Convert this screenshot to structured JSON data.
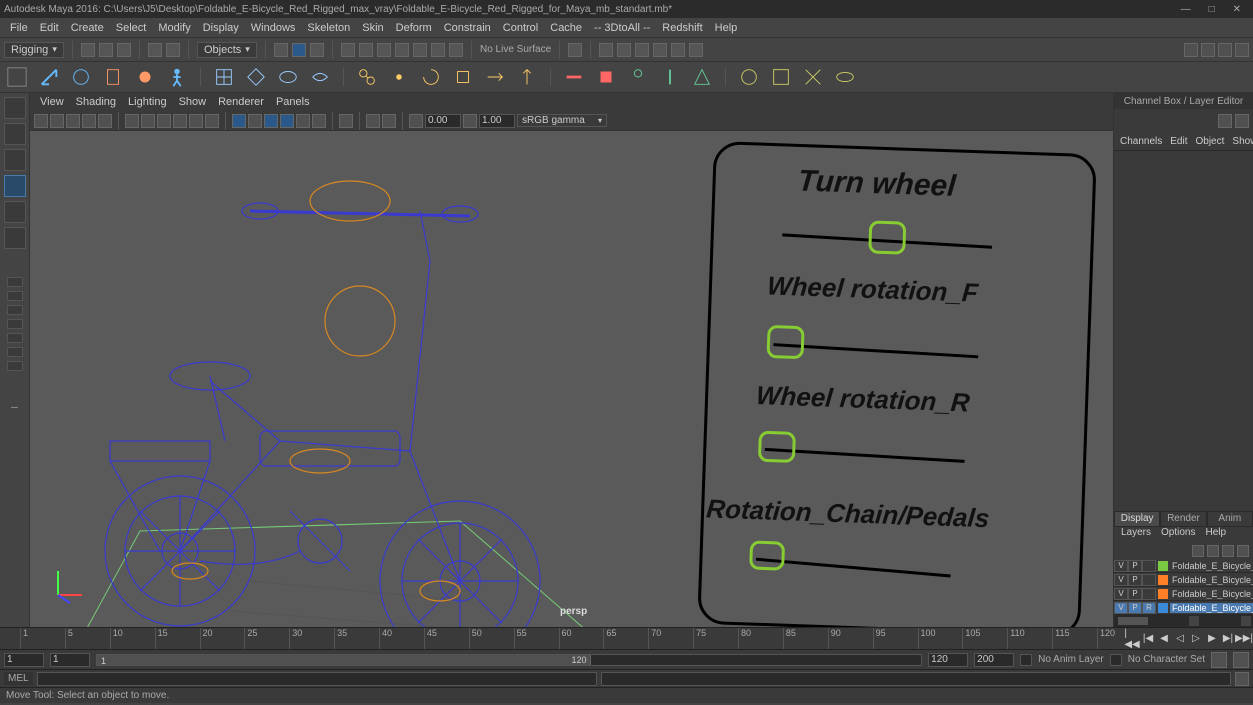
{
  "title": "Autodesk Maya 2016: C:\\Users\\J5\\Desktop\\Foldable_E-Bicycle_Red_Rigged_max_vray\\Foldable_E-Bicycle_Red_Rigged_for_Maya_mb_standart.mb*",
  "menu": [
    "File",
    "Edit",
    "Create",
    "Select",
    "Modify",
    "Display",
    "Windows",
    "Skeleton",
    "Skin",
    "Deform",
    "Constrain",
    "Control",
    "Cache",
    "-- 3DtoAll --",
    "Redshift",
    "Help"
  ],
  "workspace_dropdown": "Rigging",
  "mask_dropdown": "Objects",
  "no_live_surface": "No Live Surface",
  "viewport": {
    "menu": [
      "View",
      "Shading",
      "Lighting",
      "Show",
      "Renderer",
      "Panels"
    ],
    "gamma_label": "sRGB gamma",
    "exposure": "0.00",
    "gamma_val": "1.00",
    "persp_label": "persp"
  },
  "control_panel": {
    "title1": "Turn wheel",
    "title2": "Wheel rotation_F",
    "title3": "Wheel rotation_R",
    "title4": "Rotation_Chain/Pedals"
  },
  "channel_box": {
    "title": "Channel Box / Layer Editor",
    "menu": [
      "Channels",
      "Edit",
      "Object",
      "Show"
    ],
    "tabs": [
      "Display",
      "Render",
      "Anim"
    ],
    "active_tab": "Display",
    "submenu": [
      "Layers",
      "Options",
      "Help"
    ],
    "layers": [
      {
        "v": "V",
        "p": "P",
        "r": "",
        "color": "#7ac943",
        "name": "Foldable_E_Bicycle_Red",
        "sel": false
      },
      {
        "v": "V",
        "p": "P",
        "r": "",
        "color": "#ff7f27",
        "name": "Foldable_E_Bicycle_Red",
        "sel": false
      },
      {
        "v": "V",
        "p": "P",
        "r": "",
        "color": "#ff7f27",
        "name": "Foldable_E_Bicycle_Red",
        "sel": false
      },
      {
        "v": "V",
        "p": "P",
        "r": "R",
        "color": "#3a8ad8",
        "name": "Foldable_E_Bicycle_Red",
        "sel": true
      }
    ]
  },
  "timeline": {
    "ticks": [
      "1",
      "5",
      "10",
      "15",
      "20",
      "25",
      "30",
      "35",
      "40",
      "45",
      "50",
      "55",
      "60",
      "65",
      "70",
      "75",
      "80",
      "85",
      "90",
      "95",
      "100",
      "105",
      "110",
      "115",
      "120"
    ]
  },
  "range": {
    "start_outer": "1",
    "start_inner": "1",
    "cur": "1",
    "end_inner_vis": "120",
    "end_inner": "120",
    "end_outer": "200",
    "anim_layer": "No Anim Layer",
    "char_set": "No Character Set"
  },
  "cmd": {
    "lang": "MEL"
  },
  "help_text": "Move Tool: Select an object to move."
}
